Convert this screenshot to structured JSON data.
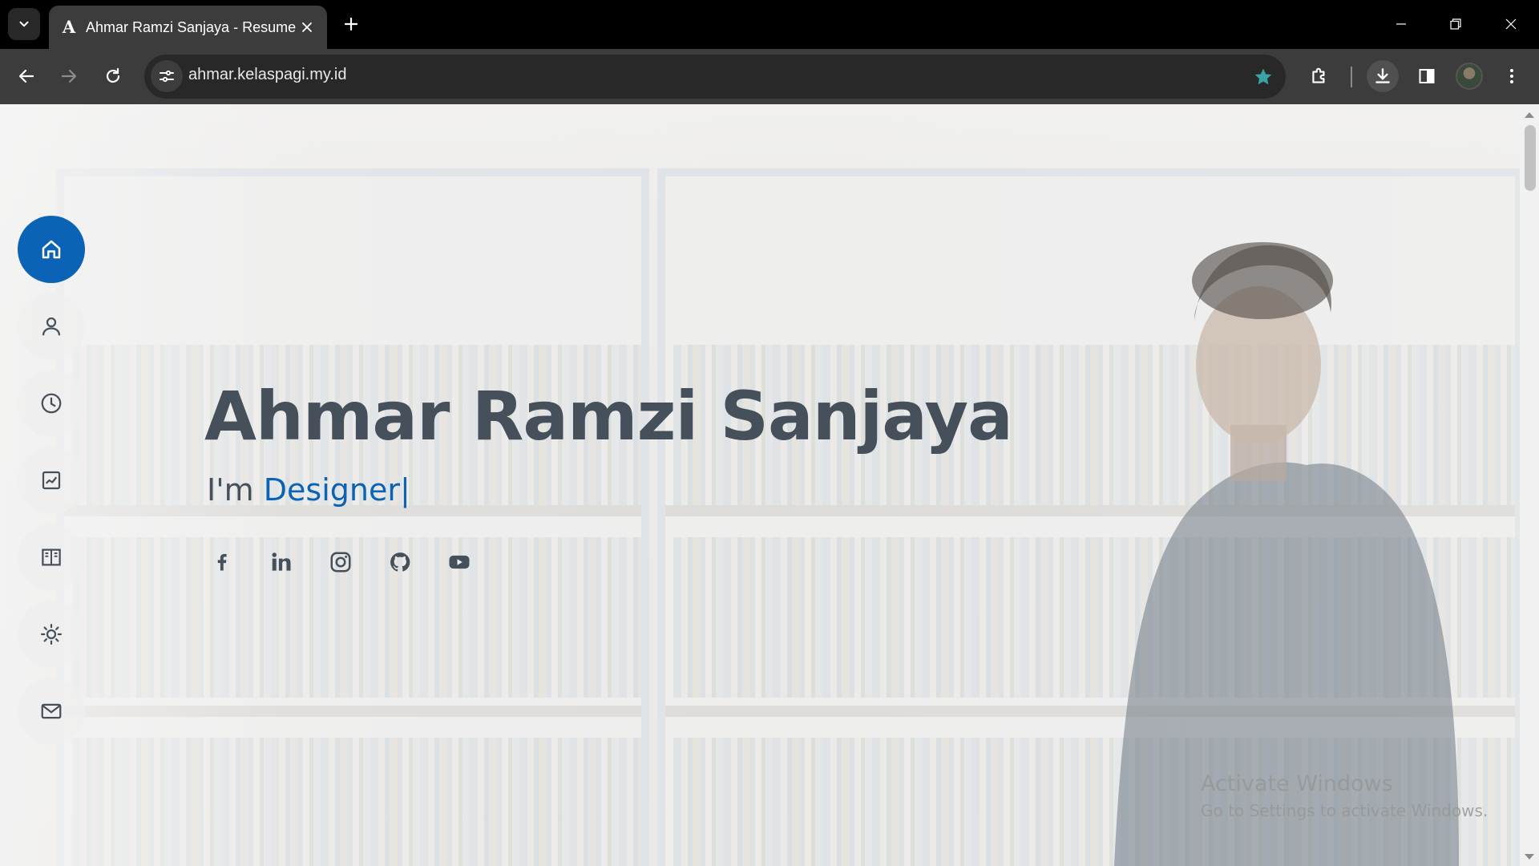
{
  "browser": {
    "tab_title": "Ahmar Ramzi Sanjaya - Resume",
    "tab_favicon": "A",
    "url": "ahmar.kelaspagi.my.id",
    "icons": [
      "tab-search-icon",
      "close-icon",
      "plus-icon",
      "minimize-icon",
      "restore-icon",
      "back-icon",
      "forward-icon",
      "reload-icon",
      "site-settings-icon",
      "star-icon",
      "extensions-icon",
      "download-icon",
      "side-panel-icon",
      "profile-avatar",
      "more-vert-icon"
    ],
    "accent_color": "#3aa3a8"
  },
  "sidebar": {
    "items": [
      {
        "name": "home",
        "icon": "home-icon",
        "active": true
      },
      {
        "name": "about",
        "icon": "user-icon"
      },
      {
        "name": "resume",
        "icon": "clock-icon"
      },
      {
        "name": "portfolio",
        "icon": "chart-icon"
      },
      {
        "name": "services",
        "icon": "book-icon"
      },
      {
        "name": "theme",
        "icon": "sun-icon"
      },
      {
        "name": "contact",
        "icon": "mail-icon"
      }
    ]
  },
  "hero": {
    "name": "Ahmar Ramzi Sanjaya",
    "prefix": "I'm ",
    "typed": "Designer",
    "caret": "|",
    "accent_color": "#0b63b5",
    "text_color": "#45505b",
    "socials": [
      "facebook-icon",
      "linkedin-icon",
      "instagram-icon",
      "github-icon",
      "youtube-icon"
    ]
  },
  "watermark": {
    "line1": "Activate Windows",
    "line2": "Go to Settings to activate Windows."
  }
}
